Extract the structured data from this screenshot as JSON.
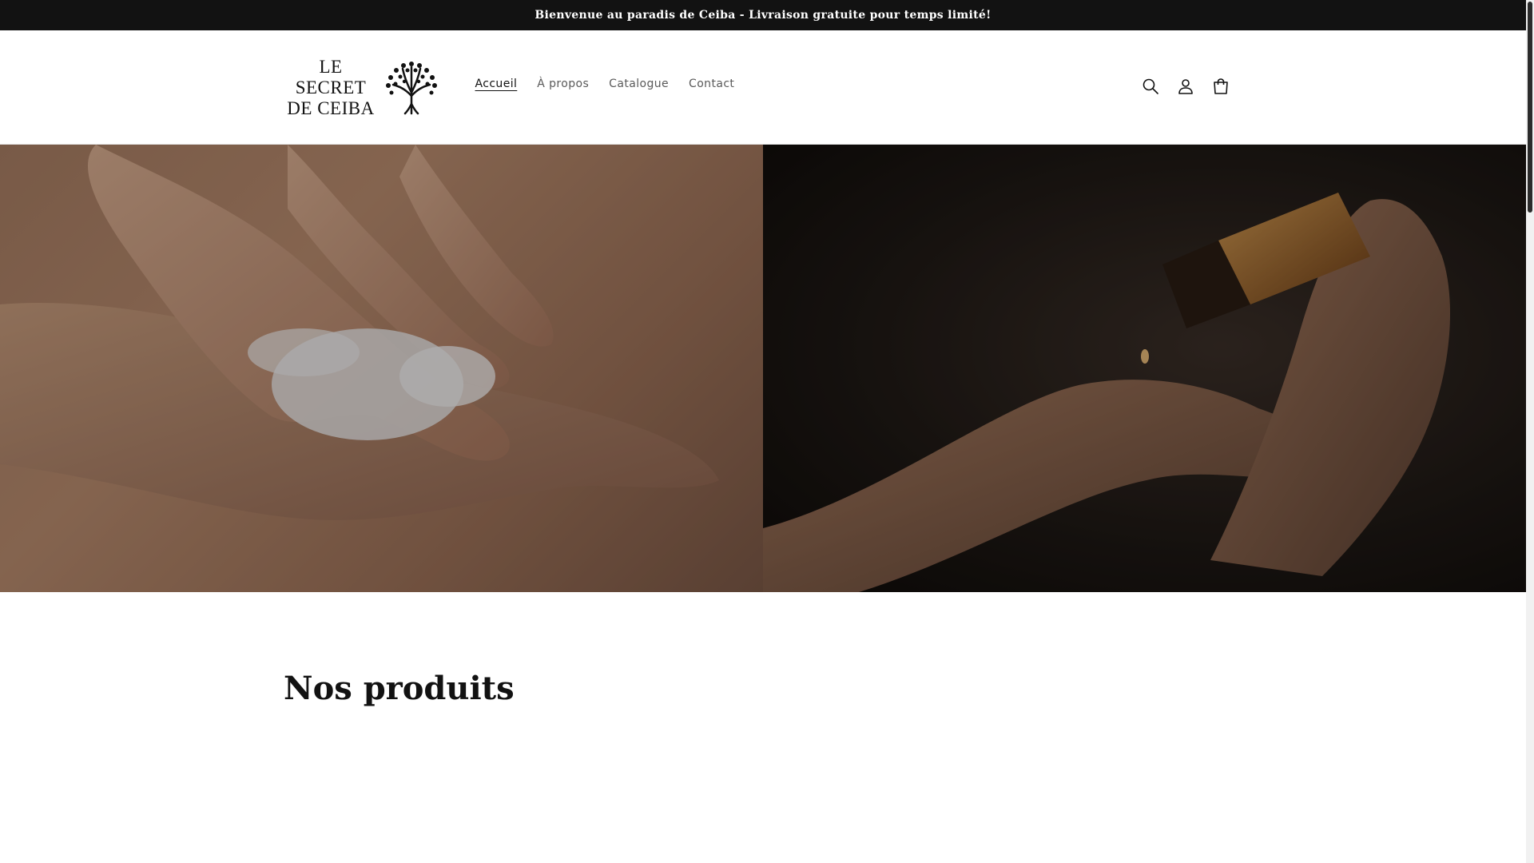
{
  "announcement": {
    "text": "Bienvenue au paradis de Ceiba - Livraison gratuite pour temps limité!"
  },
  "brand": {
    "line1": "LE SECRET",
    "line2": "DE CEIBA"
  },
  "nav": {
    "items": [
      {
        "label": "Accueil",
        "active": true
      },
      {
        "label": "À propos",
        "active": false
      },
      {
        "label": "Catalogue",
        "active": false
      },
      {
        "label": "Contact",
        "active": false
      }
    ]
  },
  "header_icons": [
    "search-icon",
    "account-icon",
    "cart-icon"
  ],
  "hero": {
    "left_image": "hands-applying-cream-image",
    "right_image": "hand-dropping-oil-image"
  },
  "products": {
    "heading": "Nos produits"
  },
  "colors": {
    "announcement_bg": "#121212",
    "text": "#121212",
    "nav_muted": "#5a5a5a"
  }
}
